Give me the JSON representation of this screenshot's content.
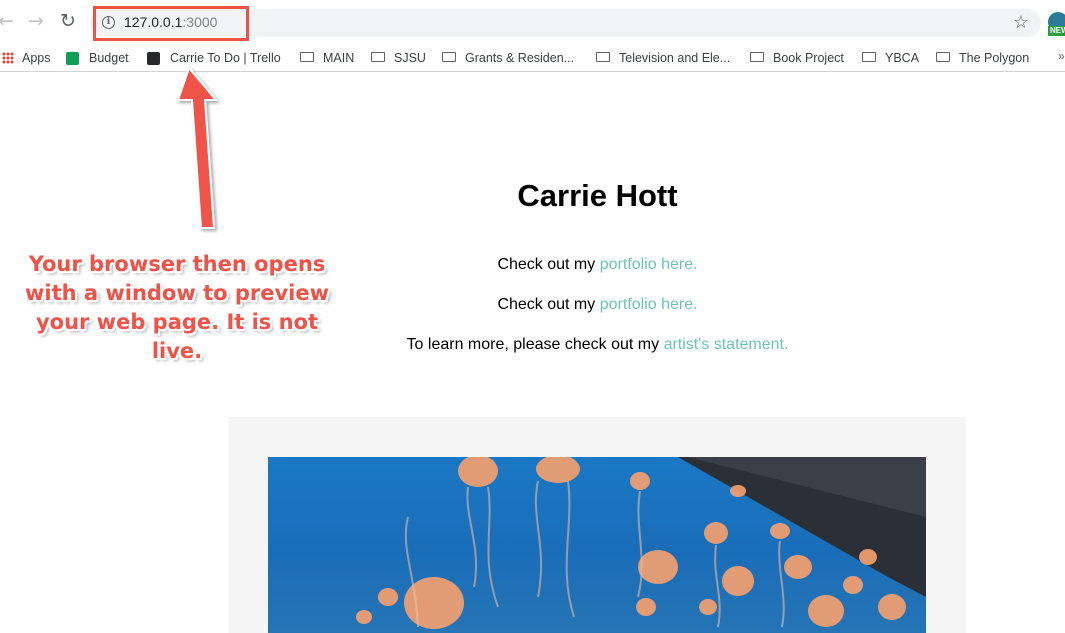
{
  "browser": {
    "url_host": "127.0.0.1",
    "url_port": ":3000",
    "bookmarks": [
      {
        "label": "Apps",
        "icon": "apps-grid-icon"
      },
      {
        "label": "Budget",
        "icon": "sheets-icon"
      },
      {
        "label": "Carrie To Do | Trello",
        "icon": "trello-icon"
      },
      {
        "label": "MAIN",
        "icon": "folder-icon"
      },
      {
        "label": "SJSU",
        "icon": "folder-icon"
      },
      {
        "label": "Grants & Residen...",
        "icon": "folder-icon"
      },
      {
        "label": "Television and Ele...",
        "icon": "folder-icon"
      },
      {
        "label": "Book Project",
        "icon": "folder-icon"
      },
      {
        "label": "YBCA",
        "icon": "folder-icon"
      },
      {
        "label": "The Polygon",
        "icon": "folder-icon"
      }
    ],
    "overflow": "»",
    "profile_badge": "NEW"
  },
  "page": {
    "title": "Carrie Hott",
    "line1_prefix": "Check out my ",
    "line1_link": "portfolio here.",
    "line2_prefix": "Check out my ",
    "line2_link": "portfolio here.",
    "line3_prefix": "To learn more, please check out my ",
    "line3_link": "artist's statement."
  },
  "annotation": {
    "callout": "Your browser then opens with a window to preview your web page. It is not live.",
    "color": "#f05247"
  },
  "colors": {
    "link": "#6cc5b4",
    "gallery_bg": "#f5f5f5"
  }
}
